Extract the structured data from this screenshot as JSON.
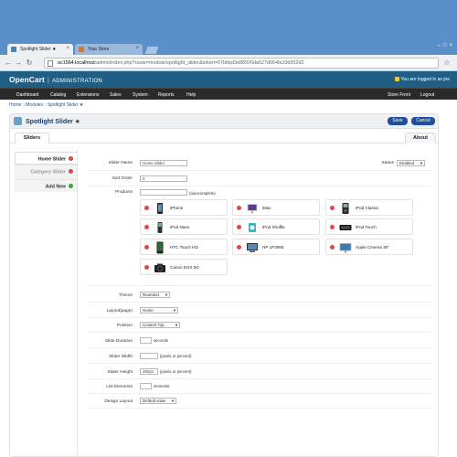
{
  "browser": {
    "tabs": [
      {
        "title": "Spotlight Slider ★",
        "active": true
      },
      {
        "title": "Your Store",
        "active": false
      }
    ],
    "url_domain": "oc1564.localhost",
    "url_path": "/admin/index.php?route=module/spotlight_slider&token=07bbbd3e88926da527d064fa10d352d2"
  },
  "header": {
    "brand": "OpenCart",
    "section": "ADMINISTRATION",
    "logged_in": "You are logged in as joe"
  },
  "menu": {
    "left": [
      "Dashboard",
      "Catalog",
      "Extensions",
      "Sales",
      "System",
      "Reports",
      "Help"
    ],
    "right": [
      "Store Front",
      "Logout"
    ]
  },
  "breadcrumb": [
    "Home",
    "Modules",
    "Spotlight Slider ★"
  ],
  "page": {
    "title": "Spotlight Slider ★",
    "save_label": "Save",
    "cancel_label": "Cancel",
    "tabs": [
      "Sliders",
      "About"
    ]
  },
  "sliders": [
    {
      "label": "Home Slider",
      "action": "remove"
    },
    {
      "label": "Category Slider",
      "action": "remove"
    },
    {
      "label": "Add New",
      "action": "add"
    }
  ],
  "form": {
    "slider_name": {
      "label": "Slider Name",
      "value": "Home Slider"
    },
    "status": {
      "label": "Status",
      "value": "Enabled"
    },
    "sort_order": {
      "label": "Sort Order",
      "value": "0"
    },
    "products": {
      "label": "Products",
      "value": "",
      "hint": "(autocomplete)"
    },
    "product_list": [
      "iPhone",
      "iMac",
      "iPod Classic",
      "iPod Nano",
      "iPod Shuffle",
      "iPod Touch",
      "HTC Touch HD",
      "HP LP3065",
      "Apple Cinema 30\"",
      "Canon EOS 5D"
    ],
    "theme": {
      "label": "Theme",
      "value": "Rounded"
    },
    "layout": {
      "label": "Layout(page)",
      "value": "Home"
    },
    "position": {
      "label": "Position",
      "value": "Content Top"
    },
    "slide_duration": {
      "label": "Slide Duration",
      "value": "",
      "hint": "seconds"
    },
    "slider_width": {
      "label": "Slider Width",
      "value": "",
      "hint": "(pixels or percent)"
    },
    "slider_height": {
      "label": "Slider Height",
      "value": "350px",
      "hint": "(pixels or percent)"
    },
    "list_elements": {
      "label": "List Elements",
      "value": "",
      "hint": "elements"
    },
    "design_layout": {
      "label": "Design Layout",
      "value": "Default value"
    }
  },
  "colors": {
    "brand_bar": "#1f5f86",
    "menu_bar": "#2a2a2a",
    "primary_button": "#1f4f9a",
    "remove_icon": "#e04a3e",
    "add_icon": "#3aa83a"
  }
}
